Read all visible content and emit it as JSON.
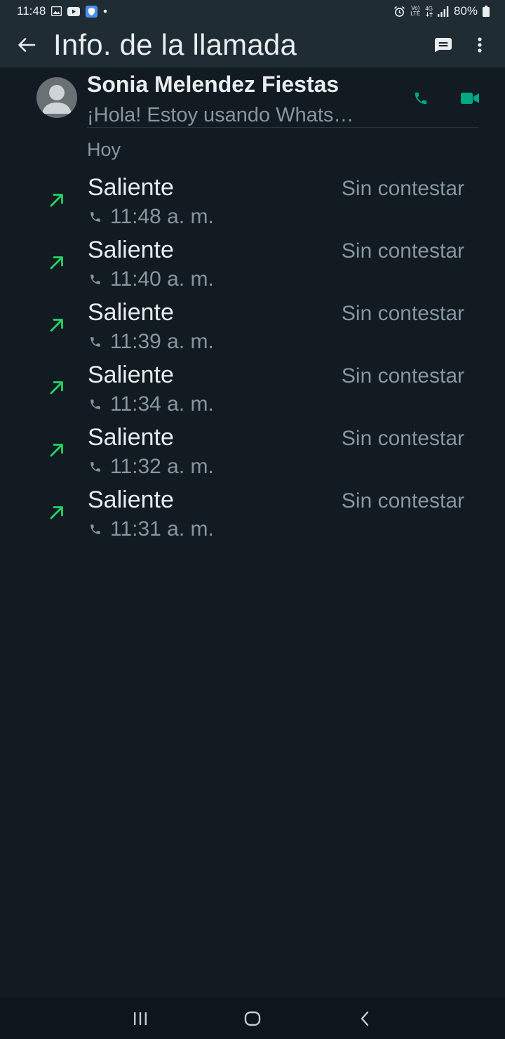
{
  "status_bar": {
    "time": "11:48",
    "battery": "80%",
    "network_4g": "4G",
    "volte_top": "Vo)",
    "volte_bottom": "LTE",
    "icons": [
      "gallery-icon",
      "youtube-icon",
      "shield-icon",
      "dot-icon",
      "alarm-icon",
      "volte-icon",
      "network-4g-icon",
      "signal-icon",
      "battery-icon"
    ]
  },
  "app_bar": {
    "title": "Info. de la llamada",
    "icons": [
      "back-arrow-icon",
      "message-icon",
      "more-vert-icon"
    ]
  },
  "contact": {
    "name": "Sonia Melendez Fiestas",
    "status": "¡Hola! Estoy usando Whats…",
    "icons": [
      "voice-call-icon",
      "video-call-icon"
    ]
  },
  "section": {
    "label": "Hoy"
  },
  "calls": [
    {
      "type": "Saliente",
      "status": "Sin contestar",
      "time": "11:48 a. m."
    },
    {
      "type": "Saliente",
      "status": "Sin contestar",
      "time": "11:40 a. m."
    },
    {
      "type": "Saliente",
      "status": "Sin contestar",
      "time": "11:39 a. m."
    },
    {
      "type": "Saliente",
      "status": "Sin contestar",
      "time": "11:34 a. m."
    },
    {
      "type": "Saliente",
      "status": "Sin contestar",
      "time": "11:32 a. m."
    },
    {
      "type": "Saliente",
      "status": "Sin contestar",
      "time": "11:31 a. m."
    }
  ],
  "nav_bar": {
    "icons": [
      "recents-icon",
      "home-icon",
      "back-icon"
    ]
  },
  "colors": {
    "background": "#121b22",
    "app_bar": "#1f2c34",
    "accent_green": "#00a884",
    "outgoing_arrow": "#25d366",
    "text_primary": "#e9edef",
    "text_secondary": "#8696a0"
  }
}
